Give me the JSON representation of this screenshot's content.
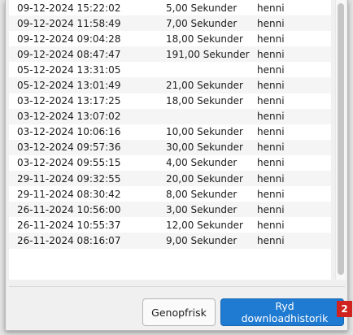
{
  "history": {
    "rows": [
      {
        "date": "09-12-2024 15:22:02",
        "duration": "5,00 Sekunder",
        "user": "henni"
      },
      {
        "date": "09-12-2024 11:58:49",
        "duration": "7,00 Sekunder",
        "user": "henni"
      },
      {
        "date": "09-12-2024 09:04:28",
        "duration": "18,00 Sekunder",
        "user": "henni"
      },
      {
        "date": "09-12-2024 08:47:47",
        "duration": "191,00 Sekunder",
        "user": "henni"
      },
      {
        "date": "05-12-2024 13:31:05",
        "duration": "",
        "user": "henni"
      },
      {
        "date": "05-12-2024 13:01:49",
        "duration": "21,00 Sekunder",
        "user": "henni"
      },
      {
        "date": "03-12-2024 13:17:25",
        "duration": "18,00 Sekunder",
        "user": "henni"
      },
      {
        "date": "03-12-2024 13:07:02",
        "duration": "",
        "user": "henni"
      },
      {
        "date": "03-12-2024 10:06:16",
        "duration": "10,00 Sekunder",
        "user": "henni"
      },
      {
        "date": "03-12-2024 09:57:36",
        "duration": "30,00 Sekunder",
        "user": "henni"
      },
      {
        "date": "03-12-2024 09:55:15",
        "duration": "4,00 Sekunder",
        "user": "henni"
      },
      {
        "date": "29-11-2024 09:32:55",
        "duration": "20,00 Sekunder",
        "user": "henni"
      },
      {
        "date": "29-11-2024 08:30:42",
        "duration": "8,00 Sekunder",
        "user": "henni"
      },
      {
        "date": "26-11-2024 10:56:00",
        "duration": "3,00 Sekunder",
        "user": "henni"
      },
      {
        "date": "26-11-2024 10:55:37",
        "duration": "12,00 Sekunder",
        "user": "henni"
      },
      {
        "date": "26-11-2024 08:16:07",
        "duration": "9,00 Sekunder",
        "user": "henni"
      }
    ]
  },
  "buttons": {
    "refresh_label": "Genopfrisk",
    "clear_label": "Ryd downloadhistorik"
  },
  "annotation": {
    "badge": "2"
  },
  "colors": {
    "primary": "#1f7ad1",
    "badge": "#d0231f"
  }
}
